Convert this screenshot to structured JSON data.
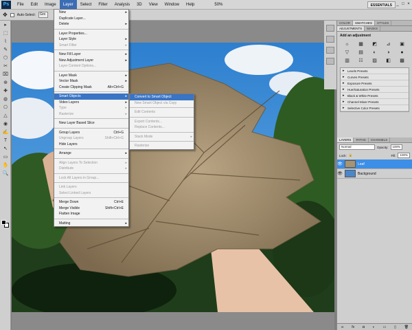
{
  "menubar": {
    "logo": "Ps",
    "items": [
      "File",
      "Edit",
      "Image",
      "Layer",
      "Select",
      "Filter",
      "Analysis",
      "3D",
      "View",
      "Window",
      "Help"
    ],
    "zoom": "50%",
    "workspace": "ESSENTIALS",
    "win_min": "_",
    "win_max": "□",
    "win_close": "×"
  },
  "options": {
    "auto_select": "Auto-Select:",
    "group": "Gro"
  },
  "layer_menu": {
    "new": "New",
    "duplicate": "Duplicate Layer...",
    "delete": "Delete",
    "props": "Layer Properties...",
    "style": "Layer Style",
    "smart_filter": "Smart Filter",
    "new_fill": "New Fill Layer",
    "new_adj": "New Adjustment Layer",
    "content_opts": "Layer Content Options...",
    "layer_mask": "Layer Mask",
    "vector_mask": "Vector Mask",
    "clip": "Create Clipping Mask",
    "clip_sc": "Alt+Ctrl+G",
    "smart_objects": "Smart Objects",
    "video_layers": "Video Layers",
    "type": "Type",
    "rasterize": "Rasterize",
    "slice": "New Layer Based Slice",
    "group": "Group Layers",
    "group_sc": "Ctrl+G",
    "ungroup": "Ungroup Layers",
    "ungroup_sc": "Shift+Ctrl+G",
    "hide": "Hide Layers",
    "arrange": "Arrange",
    "align": "Align Layers To Selection",
    "distribute": "Distribute",
    "lock": "Lock All Layers in Group...",
    "link": "Link Layers",
    "select_linked": "Select Linked Layers",
    "merge_down": "Merge Down",
    "merge_down_sc": "Ctrl+E",
    "merge_visible": "Merge Visible",
    "merge_visible_sc": "Shift+Ctrl+E",
    "flatten": "Flatten Image",
    "matting": "Matting"
  },
  "smart_menu": {
    "convert": "Convert to Smart Object",
    "new_via_copy": "New Smart Object via Copy",
    "edit": "Edit Contents",
    "export": "Export Contents...",
    "replace": "Replace Contents...",
    "stack": "Stack Mode",
    "rasterize": "Rasterize"
  },
  "panels": {
    "top_tabs": [
      "COLOR",
      "SWATCHES",
      "STYLES"
    ],
    "adj_tabs": [
      "ADJUSTMENTS",
      "MASKS"
    ],
    "adj_title": "Add an adjustment",
    "adj_icons": [
      "☼",
      "▦",
      "◩",
      "⊿",
      "▣",
      "▽",
      "▤",
      "◐",
      "◑",
      "●",
      "▥",
      "☷",
      "▨",
      "◧",
      "▩"
    ],
    "presets": [
      "Levels Presets",
      "Curves Presets",
      "Exposure Presets",
      "Hue/Saturation Presets",
      "Black & White Presets",
      "Channel Mixer Presets",
      "Selective Color Presets"
    ],
    "layer_tabs": [
      "LAYERS",
      "PATHS",
      "CHANNELS"
    ],
    "blend": "Normal",
    "opacity_label": "Opacity:",
    "opacity": "100%",
    "lock_label": "Lock:",
    "fill_label": "Fill:",
    "fill": "100%",
    "layers": [
      {
        "name": "Leaf",
        "selected": true
      },
      {
        "name": "Background",
        "selected": false
      }
    ],
    "footer": [
      "∞",
      "fx",
      "◘",
      "◐",
      "▭",
      "▯",
      "🗑"
    ]
  },
  "tools": [
    "▸",
    "⬚",
    "⌇",
    "✎",
    "⬡",
    "✂",
    "⌧",
    "⊕",
    "✚",
    "◍",
    "⎔",
    "△",
    "◉",
    "✍",
    "T",
    "↖",
    "▭",
    "✋",
    "🔍"
  ],
  "colors": {
    "menu_highlight": "#3a74c4",
    "layer_selected": "#3d8ee6"
  }
}
